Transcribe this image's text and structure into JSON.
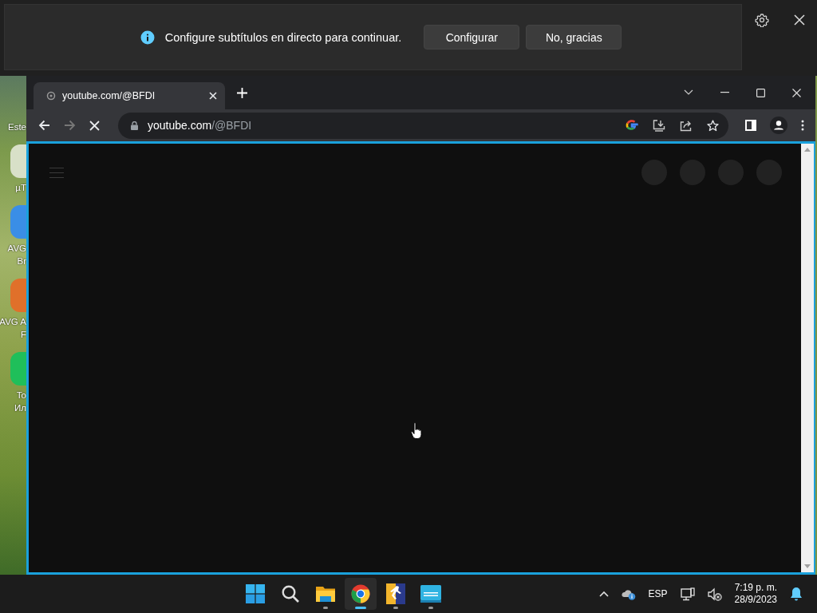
{
  "caption_banner": {
    "message": "Configure subtítulos en directo para continuar.",
    "buttons": [
      "Configurar",
      "No, gracias"
    ]
  },
  "desktop_icons": [
    {
      "lines": [
        "Este"
      ]
    },
    {
      "lines": [
        "µT"
      ]
    },
    {
      "lines": [
        "AVG",
        "Br"
      ]
    },
    {
      "lines": [
        "AVG A",
        "F"
      ]
    },
    {
      "lines": [
        "To",
        "Ил"
      ]
    }
  ],
  "browser": {
    "tabs": [
      {
        "title": "youtube.com/@BFDI",
        "selected": true
      }
    ],
    "address": {
      "host": "youtube.com",
      "path": "/@BFDI"
    },
    "loading": true
  },
  "taskbar": {
    "apps": [
      {
        "kind": "start",
        "running": false,
        "selected": false
      },
      {
        "kind": "search",
        "running": false,
        "selected": false
      },
      {
        "kind": "files",
        "running": true,
        "selected": false
      },
      {
        "kind": "chrome",
        "running": true,
        "selected": true
      },
      {
        "kind": "game",
        "running": true,
        "selected": false
      },
      {
        "kind": "screen",
        "running": true,
        "selected": false
      }
    ],
    "language": "ESP",
    "time": "7:19 p. m.",
    "date": "28/9/2023"
  }
}
